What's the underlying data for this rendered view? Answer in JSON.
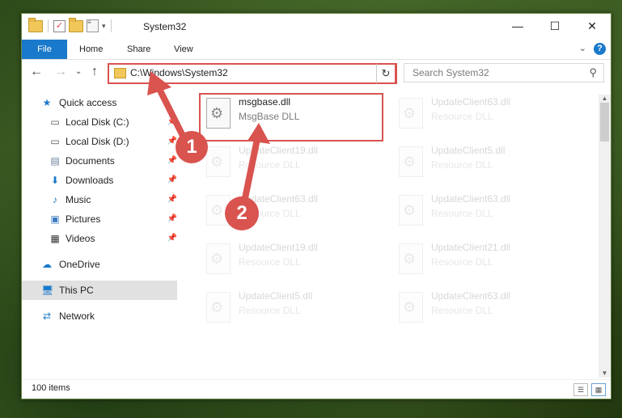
{
  "window": {
    "title": "System32"
  },
  "ribbon": {
    "tabs": [
      "File",
      "Home",
      "Share",
      "View"
    ]
  },
  "address": {
    "path": "C:\\Windows\\System32"
  },
  "search": {
    "placeholder": "Search System32"
  },
  "nav": {
    "items": [
      {
        "label": "Quick access",
        "icon": "star-icon"
      },
      {
        "label": "Local Disk (C:)",
        "icon": "drive-icon",
        "pinned": true
      },
      {
        "label": "Local Disk (D:)",
        "icon": "drive-icon",
        "pinned": true
      },
      {
        "label": "Documents",
        "icon": "documents-icon",
        "pinned": true
      },
      {
        "label": "Downloads",
        "icon": "download-icon",
        "pinned": true
      },
      {
        "label": "Music",
        "icon": "music-icon",
        "pinned": true
      },
      {
        "label": "Pictures",
        "icon": "pictures-icon",
        "pinned": true
      },
      {
        "label": "Videos",
        "icon": "videos-icon",
        "pinned": true
      },
      {
        "label": "OneDrive",
        "icon": "cloud-icon"
      },
      {
        "label": "This PC",
        "icon": "computer-icon"
      },
      {
        "label": "Network",
        "icon": "network-icon"
      }
    ]
  },
  "files": [
    {
      "name": "msgbase.dll",
      "type": "MsgBase DLL"
    },
    {
      "name": "UpdateClient63.dll",
      "type": "Resource DLL"
    },
    {
      "name": "UpdateClient19.dll",
      "type": "Resource DLL"
    },
    {
      "name": "UpdateClient5.dll",
      "type": "Resource DLL"
    },
    {
      "name": "UpdateClient63.dll",
      "type": "Resource DLL"
    },
    {
      "name": "UpdateClient63.dll",
      "type": "Resource DLL"
    },
    {
      "name": "UpdateClient19.dll",
      "type": "Resource DLL"
    },
    {
      "name": "UpdateClient21.dll",
      "type": "Resource DLL"
    },
    {
      "name": "UpdateClient5.dll",
      "type": "Resource DLL"
    },
    {
      "name": "UpdateClient63.dll",
      "type": "Resource DLL"
    }
  ],
  "status": {
    "item_count": "100 items"
  },
  "callouts": [
    "1",
    "2"
  ],
  "colors": {
    "accent": "#1979ca",
    "highlight": "#d9534f"
  }
}
